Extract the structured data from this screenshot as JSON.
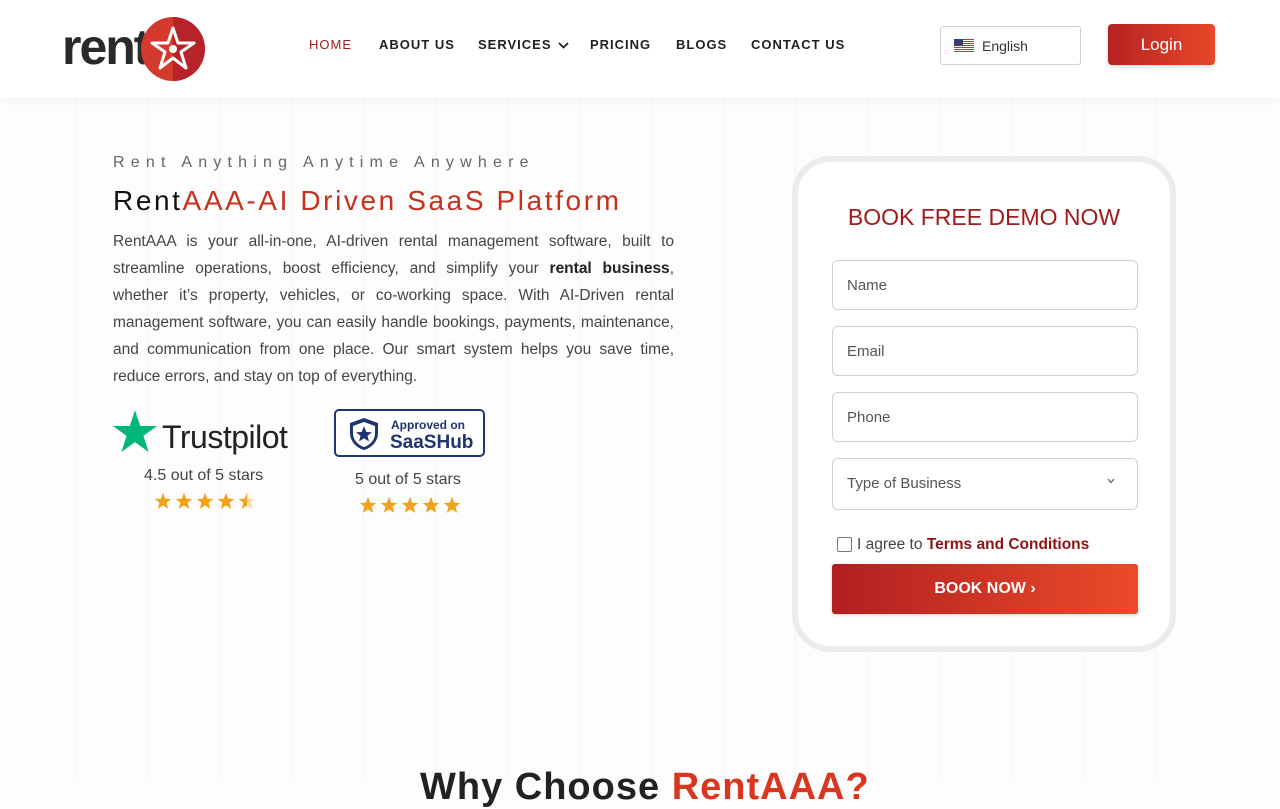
{
  "header": {
    "logo_text": "rent",
    "nav": [
      {
        "label": "HOME",
        "active": true
      },
      {
        "label": "ABOUT US"
      },
      {
        "label": "SERVICES",
        "has_dropdown": true
      },
      {
        "label": "PRICING"
      },
      {
        "label": "BLOGS"
      },
      {
        "label": "CONTACT US"
      }
    ],
    "language": {
      "label": "English",
      "flag": "us-flag-icon"
    },
    "login_label": "Login"
  },
  "hero": {
    "tagline": "Rent Anything Anytime Anywhere",
    "headline": {
      "part1": "Rent",
      "part2": "AAA-AI Driven SaaS Platform"
    },
    "description_before": "RentAAA is your all-in-one, AI-driven rental management software, built to streamline operations, boost efficiency, and simplify your ",
    "description_bold": "rental business",
    "description_after": ", whether it’s property, vehicles, or co-working space. With AI-Driven rental management software, you can easily handle bookings, payments, maintenance, and communication from one place. Our smart system helps you save time, reduce errors, and stay on top of everything."
  },
  "ratings": {
    "trustpilot": {
      "name": "Trustpilot",
      "text": "4.5 out of 5 stars",
      "stars": 4.5
    },
    "saashub": {
      "line1": "Approved on",
      "line2": "SaaSHub",
      "text": "5 out of 5 stars",
      "stars": 5
    }
  },
  "form": {
    "title": "BOOK FREE DEMO NOW",
    "name_placeholder": "Name",
    "email_placeholder": "Email",
    "phone_placeholder": "Phone",
    "business_type": "Type of Business",
    "agree_text": "I agree to ",
    "terms_link": "Terms and Conditions",
    "submit_label": "BOOK NOW ›"
  },
  "next_section": {
    "part1": "Why Choose ",
    "part2": "RentAAA?"
  },
  "colors": {
    "accent": "#a01b1b",
    "brand_red": "#c5311b",
    "star": "#f0a21a",
    "trustpilot_green": "#00b67a"
  }
}
